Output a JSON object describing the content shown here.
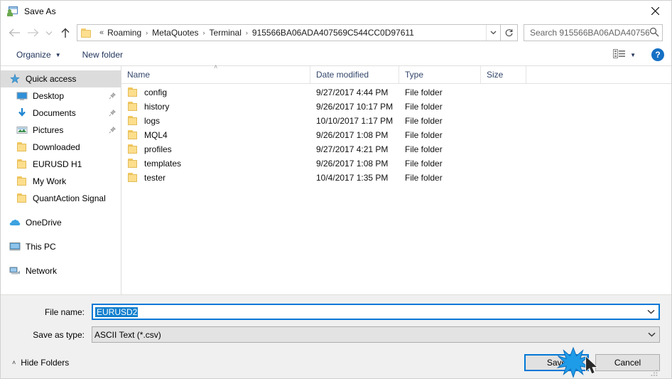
{
  "window": {
    "title": "Save As",
    "app_icon": "save-as-icon",
    "close_label": "✕"
  },
  "navigation": {
    "back": "←",
    "forward": "→",
    "recent": "⌄",
    "up": "↑",
    "breadcrumb_prefix": "«",
    "breadcrumbs": [
      "Roaming",
      "MetaQuotes",
      "Terminal",
      "915566BA06ADA407569C544CC0D97611"
    ],
    "breadcrumb_separator": "›",
    "dropdown": "⌄",
    "refresh": "↻"
  },
  "search": {
    "placeholder": "Search 915566BA06ADA40756...",
    "value": "",
    "icon": "search-icon"
  },
  "toolbar": {
    "organize": "Organize",
    "organize_caret": "▼",
    "new_folder": "New folder",
    "view_caret": "▼",
    "help": "?"
  },
  "sidebar": {
    "items": [
      {
        "label": "Quick access",
        "icon": "star-icon",
        "level": 0,
        "selected": true,
        "pinned": false
      },
      {
        "label": "Desktop",
        "icon": "desktop-icon",
        "level": 1,
        "selected": false,
        "pinned": true
      },
      {
        "label": "Documents",
        "icon": "documents-icon",
        "level": 1,
        "selected": false,
        "pinned": true
      },
      {
        "label": "Pictures",
        "icon": "pictures-icon",
        "level": 1,
        "selected": false,
        "pinned": true
      },
      {
        "label": "Downloaded",
        "icon": "folder-icon",
        "level": 1,
        "selected": false,
        "pinned": false
      },
      {
        "label": "EURUSD H1",
        "icon": "folder-icon",
        "level": 1,
        "selected": false,
        "pinned": false
      },
      {
        "label": "My Work",
        "icon": "folder-icon",
        "level": 1,
        "selected": false,
        "pinned": false
      },
      {
        "label": "QuantAction Signal",
        "icon": "folder-icon",
        "level": 1,
        "selected": false,
        "pinned": false
      },
      {
        "label": "OneDrive",
        "icon": "onedrive-icon",
        "level": 0,
        "selected": false,
        "pinned": false,
        "group": true
      },
      {
        "label": "This PC",
        "icon": "thispc-icon",
        "level": 0,
        "selected": false,
        "pinned": false,
        "group": true
      },
      {
        "label": "Network",
        "icon": "network-icon",
        "level": 0,
        "selected": false,
        "pinned": false,
        "group": true
      }
    ]
  },
  "filelist": {
    "columns": [
      "Name",
      "Date modified",
      "Type",
      "Size"
    ],
    "sort_indicator": "˄",
    "rows": [
      {
        "name": "config",
        "date": "9/27/2017 4:44 PM",
        "type": "File folder",
        "size": ""
      },
      {
        "name": "history",
        "date": "9/26/2017 10:17 PM",
        "type": "File folder",
        "size": ""
      },
      {
        "name": "logs",
        "date": "10/10/2017 1:17 PM",
        "type": "File folder",
        "size": ""
      },
      {
        "name": "MQL4",
        "date": "9/26/2017 1:08 PM",
        "type": "File folder",
        "size": ""
      },
      {
        "name": "profiles",
        "date": "9/27/2017 4:21 PM",
        "type": "File folder",
        "size": ""
      },
      {
        "name": "templates",
        "date": "9/26/2017 1:08 PM",
        "type": "File folder",
        "size": ""
      },
      {
        "name": "tester",
        "date": "10/4/2017 1:35 PM",
        "type": "File folder",
        "size": ""
      }
    ]
  },
  "form": {
    "filename_label": "File name:",
    "filename_value": "EURUSD2",
    "filetype_label": "Save as type:",
    "filetype_value": "ASCII Text (*.csv)",
    "combo_arrow": "⌄"
  },
  "footer": {
    "hide_folders": "Hide Folders",
    "hide_folders_caret": "˄",
    "save": "Save",
    "cancel": "Cancel"
  },
  "colors": {
    "accent": "#0078d7",
    "selection": "#1380ce",
    "selected_row": "#dcdcdc",
    "folder": "#fcde8c",
    "help_blue": "#1570c4"
  }
}
